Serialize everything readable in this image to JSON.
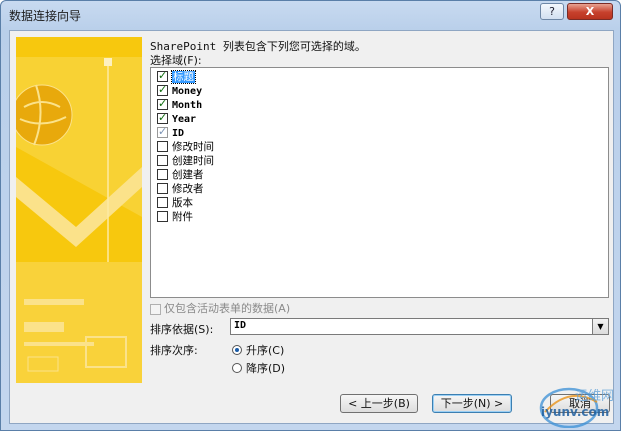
{
  "window": {
    "title": "数据连接向导",
    "help_label": "?",
    "close_label": "X"
  },
  "main": {
    "prompt": "SharePoint 列表包含下列您可选择的域。",
    "fields_label": "选择域(F):",
    "fields": [
      {
        "label": "标题",
        "checked": true,
        "selected": true,
        "disabled": false,
        "mono": false
      },
      {
        "label": "Money",
        "checked": true,
        "selected": false,
        "disabled": false,
        "mono": true
      },
      {
        "label": "Month",
        "checked": true,
        "selected": false,
        "disabled": false,
        "mono": true
      },
      {
        "label": "Year",
        "checked": true,
        "selected": false,
        "disabled": false,
        "mono": true
      },
      {
        "label": "ID",
        "checked": true,
        "selected": false,
        "disabled": true,
        "mono": true
      },
      {
        "label": "修改时间",
        "checked": false,
        "selected": false,
        "disabled": false,
        "mono": false
      },
      {
        "label": "创建时间",
        "checked": false,
        "selected": false,
        "disabled": false,
        "mono": false
      },
      {
        "label": "创建者",
        "checked": false,
        "selected": false,
        "disabled": false,
        "mono": false
      },
      {
        "label": "修改者",
        "checked": false,
        "selected": false,
        "disabled": false,
        "mono": false
      },
      {
        "label": "版本",
        "checked": false,
        "selected": false,
        "disabled": false,
        "mono": false
      },
      {
        "label": "附件",
        "checked": false,
        "selected": false,
        "disabled": false,
        "mono": false
      }
    ],
    "only_active_label": "仅包含活动表单的数据(A)",
    "sort_label": "排序依据(S):",
    "sort_value": "ID",
    "order_label": "排序次序:",
    "ascending_label": "升序(C)",
    "descending_label": "降序(D)",
    "order_selected": "ascending"
  },
  "buttons": {
    "back": "< 上一步(B)",
    "next": "下一步(N) >",
    "cancel": "取消"
  },
  "watermark": {
    "brand": "运维网",
    "url": "iyunv.com"
  },
  "colors": {
    "art_yellow": "#f7c80e",
    "selection": "#3399ff",
    "close_red": "#c7402c"
  }
}
